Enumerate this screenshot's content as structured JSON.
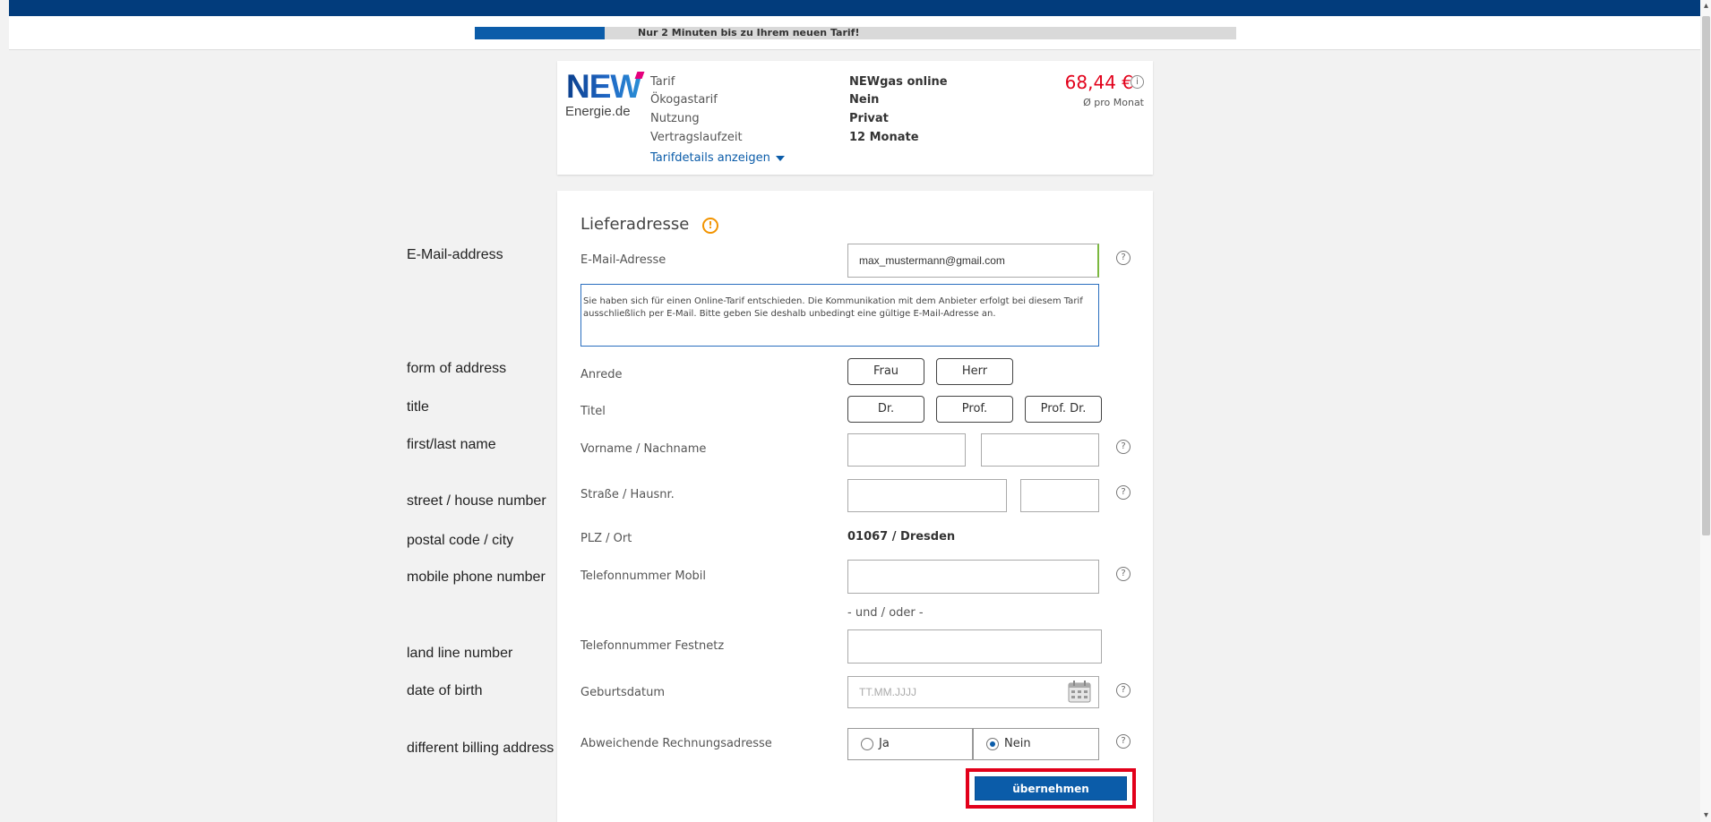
{
  "progress": {
    "text": "Nur 2 Minuten bis zu Ihrem neuen Tarif!",
    "percent": 16
  },
  "tariff": {
    "logo_main": "NEW",
    "logo_sub": "Energie.de",
    "rows": [
      {
        "label": "Tarif",
        "value": "NEWgas online"
      },
      {
        "label": "Ökogastarif",
        "value": "Nein"
      },
      {
        "label": "Nutzung",
        "value": "Privat"
      },
      {
        "label": "Vertragslaufzeit",
        "value": "12 Monate"
      }
    ],
    "details_link": "Tarifdetails anzeigen",
    "price": "68,44 €",
    "price_info": "i",
    "price_sub": "Ø pro Monat"
  },
  "english_labels": {
    "email": "E-Mail-address",
    "form_of_address": "form of address",
    "title": "title",
    "name": "first/last name",
    "street": "street / house number",
    "postal": "postal code / city",
    "mobile": "mobile phone number",
    "landline": "land line number",
    "dob": "date of birth",
    "billing": "different billing address"
  },
  "form": {
    "section_title": "Lieferadresse",
    "warn_icon": "!",
    "help_icon": "?",
    "email_label": "E-Mail-Adresse",
    "email_value": "max_mustermann@gmail.com",
    "email_info": "Sie haben sich für einen Online-Tarif entschieden. Die Kommunikation mit dem Anbieter erfolgt bei diesem Tarif ausschließlich per E-Mail. Bitte geben Sie deshalb unbedingt eine gültige E-Mail-Adresse an.",
    "salutation_label": "Anrede",
    "salutation_options": [
      "Frau",
      "Herr"
    ],
    "title_label": "Titel",
    "title_options": [
      "Dr.",
      "Prof.",
      "Prof. Dr."
    ],
    "name_label": "Vorname / Nachname",
    "street_label": "Straße / Hausnr.",
    "postal_label": "PLZ / Ort",
    "postal_value": "01067 / Dresden",
    "mobile_label": "Telefonnummer Mobil",
    "and_or": "- und / oder -",
    "landline_label": "Telefonnummer Festnetz",
    "dob_label": "Geburtsdatum",
    "dob_placeholder": "TT.MM.JJJJ",
    "billing_label": "Abweichende Rechnungsadresse",
    "billing_options": [
      "Ja",
      "Nein"
    ],
    "billing_selected": "Nein",
    "submit": "übernehmen"
  },
  "colors": {
    "primary": "#0b5ca9",
    "header": "#023c7c",
    "price": "#e2001a",
    "highlight": "#e2001a",
    "warning": "#f29400"
  }
}
